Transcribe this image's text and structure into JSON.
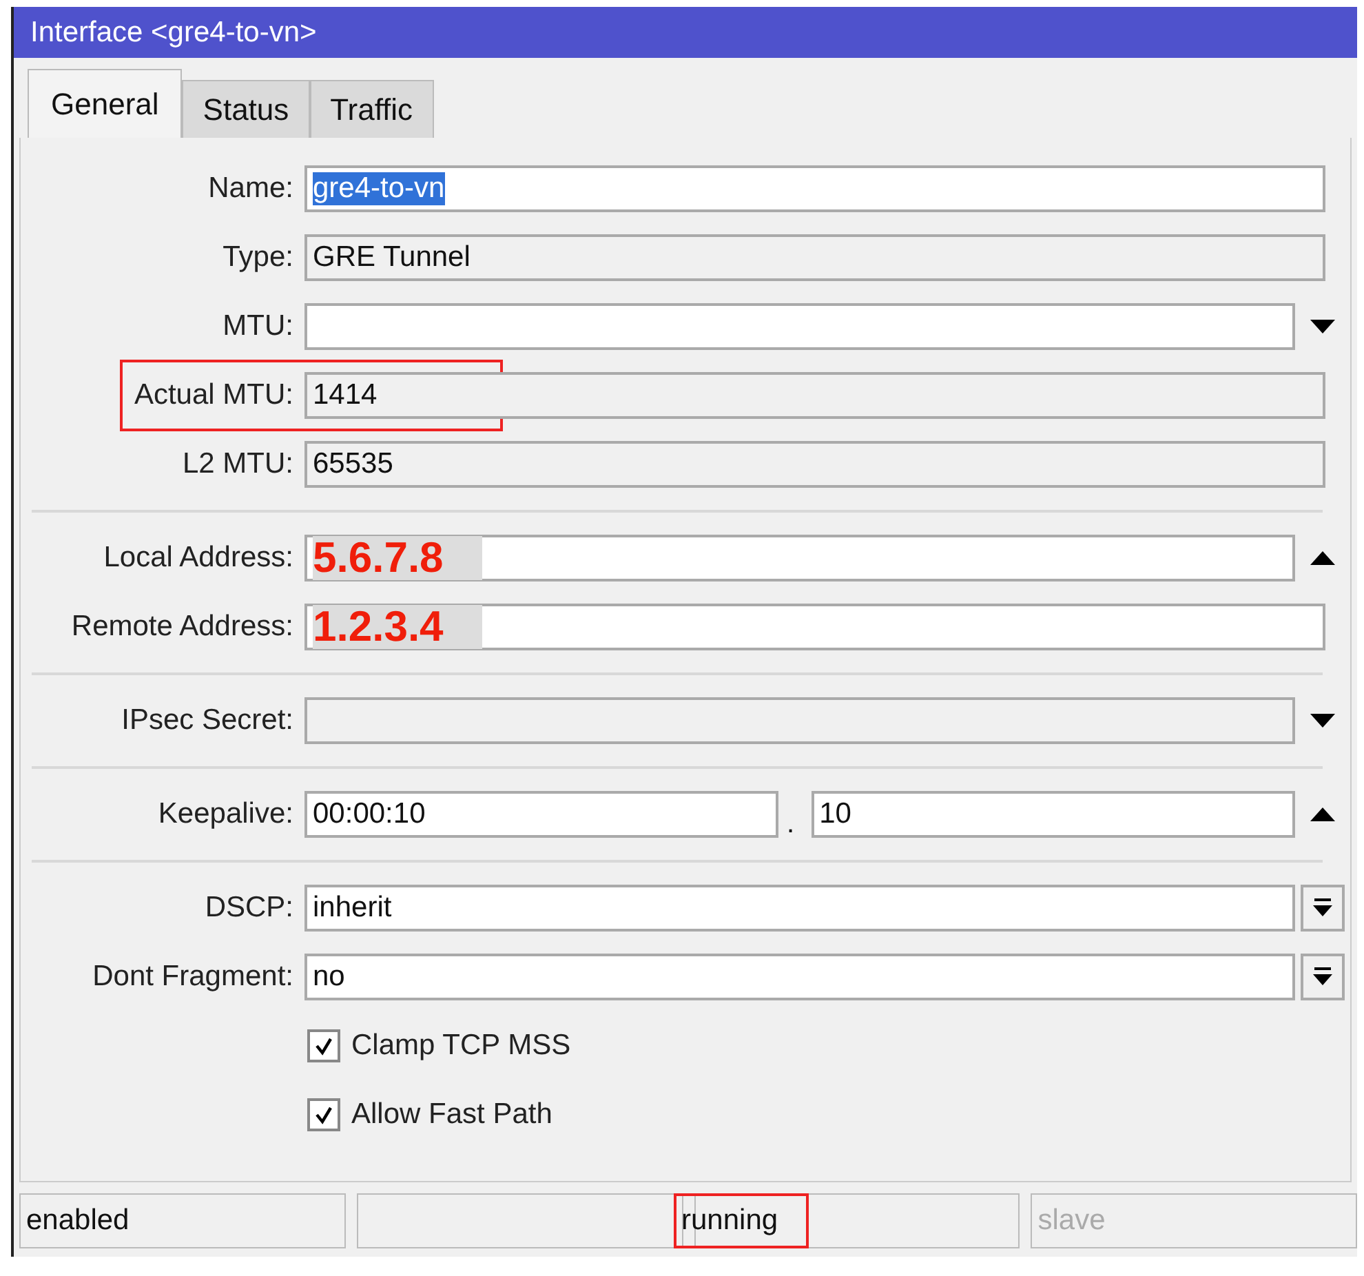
{
  "window": {
    "title": "Interface <gre4-to-vn>"
  },
  "tabs": [
    {
      "label": "General",
      "selected": true
    },
    {
      "label": "Status",
      "selected": false
    },
    {
      "label": "Traffic",
      "selected": false
    }
  ],
  "sections": [
    [
      {
        "kind": "plain",
        "label": "Name:",
        "value": "gre4-to-vn",
        "value_selected": true
      },
      {
        "kind": "plain",
        "label": "Type:",
        "value": "GRE Tunnel",
        "readonly": true
      },
      {
        "kind": "down",
        "label": "MTU:"
      },
      {
        "kind": "plain",
        "label": "Actual MTU:",
        "value": "1414",
        "readonly": true,
        "highlighted": true
      },
      {
        "kind": "plain",
        "label": "L2 MTU:",
        "value": "65535",
        "readonly": true
      }
    ],
    [
      {
        "kind": "up",
        "label": "Local Address:",
        "value": "5.6.7.8",
        "redacted": true
      },
      {
        "kind": "plain",
        "label": "Remote Address:",
        "value": "1.2.3.4",
        "redacted": true
      }
    ],
    [
      {
        "kind": "down",
        "label": "IPsec Secret:",
        "readonly": true
      }
    ],
    [
      {
        "kind": "up",
        "label": "Keepalive:",
        "value": "00:00:10",
        "value2": "10",
        "separator": "."
      }
    ],
    [
      {
        "kind": "dropdown",
        "label": "DSCP:",
        "value": "inherit"
      },
      {
        "kind": "dropdown",
        "label": "Dont Fragment:",
        "value": "no"
      }
    ]
  ],
  "checkboxes": [
    {
      "label": "Clamp TCP MSS",
      "checked": true
    },
    {
      "label": "Allow Fast Path",
      "checked": true
    }
  ],
  "status_bar": [
    {
      "kind": "text",
      "text": "enabled"
    },
    {
      "kind": "empty"
    },
    {
      "kind": "text",
      "text": "running",
      "highlighted": true
    },
    {
      "kind": "text",
      "text": "slave",
      "disabled": true
    }
  ]
}
